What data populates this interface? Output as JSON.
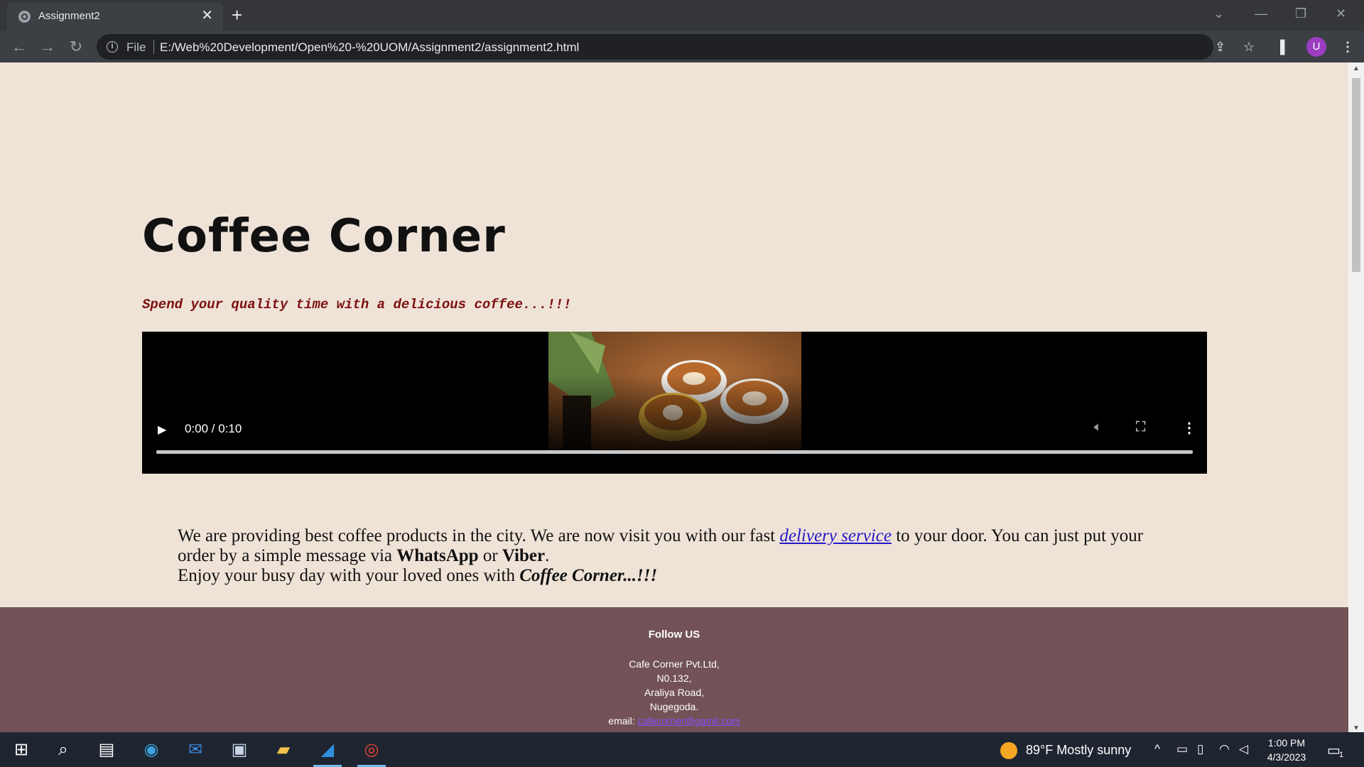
{
  "browser": {
    "tab_title": "Assignment2",
    "tab_close": "✕",
    "new_tab": "+",
    "url_scheme_label": "File",
    "url": "E:/Web%20Development/Open%20-%20UOM/Assignment2/assignment2.html",
    "profile_initial": "U",
    "profile_color": "#9b3dbf"
  },
  "page": {
    "title": "Coffee Corner",
    "tagline": "Spend your quality time with a delicious coffee...!!!",
    "video": {
      "time": "0:00 / 0:10",
      "progress": 0
    },
    "paragraph": {
      "part1": "We are providing best coffee products in the city. We are now visit you with our fast ",
      "link": "delivery service",
      "part2": " to your door. You can just put your order by a simple message via ",
      "whatsapp": "WhatsApp",
      "or": " or ",
      "viber": "Viber",
      "period": ".",
      "line2_start": "Enjoy your busy day with your loved ones with ",
      "brand": "Coffee Corner...!!!"
    },
    "footer": {
      "heading": "Follow US",
      "company": "Cafe Corner Pvt.Ltd,",
      "number": "N0.132,",
      "road": "Araliya Road,",
      "city": "Nugegoda.",
      "email_label": "email: ",
      "email": "cafecorner@gamil.com"
    },
    "colors": {
      "background": "#efe3d8",
      "footer": "#735257",
      "tagline": "#7d1010",
      "link": "#2418c9"
    }
  },
  "taskbar": {
    "weather": "89°F  Mostly sunny",
    "time": "1:00 PM",
    "date": "4/3/2023",
    "notification_count": "1"
  }
}
